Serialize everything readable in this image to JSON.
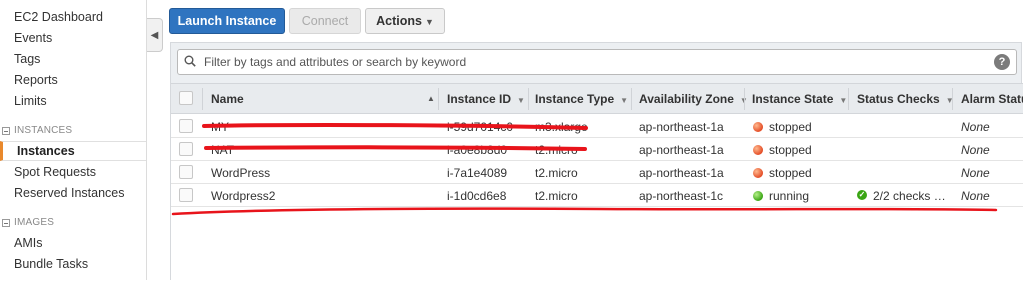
{
  "sidebar": {
    "items_top": [
      "EC2 Dashboard",
      "Events",
      "Tags",
      "Reports",
      "Limits"
    ],
    "section_instances": "INSTANCES",
    "instances_items": [
      "Instances",
      "Spot Requests",
      "Reserved Instances"
    ],
    "section_images": "IMAGES",
    "images_items": [
      "AMIs",
      "Bundle Tasks"
    ],
    "collapse_glyph": "◀"
  },
  "toolbar": {
    "launch_label": "Launch Instance",
    "connect_label": "Connect",
    "actions_label": "Actions"
  },
  "search": {
    "placeholder": "Filter by tags and attributes or search by keyword",
    "help_glyph": "?"
  },
  "table": {
    "headers": [
      "Name",
      "Instance ID",
      "Instance Type",
      "Availability Zone",
      "Instance State",
      "Status Checks",
      "Alarm Status"
    ],
    "rows": [
      {
        "name": "MY",
        "id": "i-59d7014c0",
        "type": "m3.xlarge",
        "az": "ap-northeast-1a",
        "state": "stopped",
        "checks": "",
        "alarm": "None"
      },
      {
        "name": "NAT",
        "id": "i-a0e8b8d0",
        "type": "t2.micro",
        "az": "ap-northeast-1a",
        "state": "stopped",
        "checks": "",
        "alarm": "None"
      },
      {
        "name": "WordPress",
        "id": "i-7a1e4089",
        "type": "t2.micro",
        "az": "ap-northeast-1a",
        "state": "stopped",
        "checks": "",
        "alarm": "None"
      },
      {
        "name": "Wordpress2",
        "id": "i-1d0cd6e8",
        "type": "t2.micro",
        "az": "ap-northeast-1c",
        "state": "running",
        "checks": "2/2 checks …",
        "alarm": "None"
      }
    ]
  },
  "colors": {
    "accent": "#2f74c0",
    "active_nav": "#e9892c",
    "stopped": "#e44d26",
    "running": "#3aa514",
    "annotation_red": "#e8141b"
  }
}
